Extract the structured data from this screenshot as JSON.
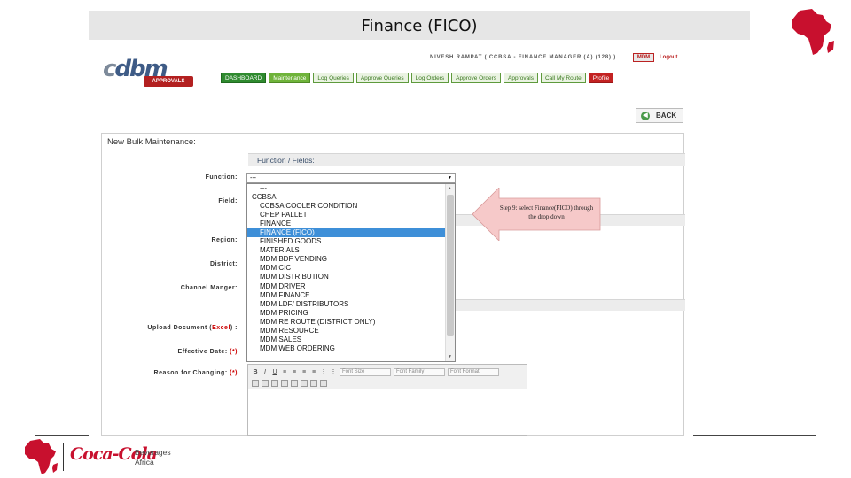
{
  "slide": {
    "title": "Finance (FICO)"
  },
  "app": {
    "brand_part1": "c",
    "brand_part2": "dbm",
    "approvals_badge": "APPROVALS",
    "user_line": "NIVESH RAMPAT ( CCBSA - FINANCE MANAGER (A) (128) )",
    "mdm_badge": "MDM",
    "logout": "Logout",
    "nav": [
      {
        "label": "DASHBOARD",
        "style": "dark"
      },
      {
        "label": "Maintenance",
        "style": "sel"
      },
      {
        "label": "Log Queries",
        "style": "normal"
      },
      {
        "label": "Approve Queries",
        "style": "normal"
      },
      {
        "label": "Log Orders",
        "style": "normal"
      },
      {
        "label": "Approve Orders",
        "style": "normal"
      },
      {
        "label": "Approvals",
        "style": "normal"
      },
      {
        "label": "Call My Route",
        "style": "normal"
      },
      {
        "label": "Profile",
        "style": "red"
      }
    ],
    "back_label": "BACK",
    "back_icon": "arrow-left-icon"
  },
  "form": {
    "panel_title": "New Bulk Maintenance:",
    "section_title": "Function / Fields:",
    "labels": {
      "function": "Function:",
      "field": "Field:",
      "region": "Region:",
      "district": "District:",
      "channel_manager": "Channel Manger:",
      "upload_prefix": "Upload Document (",
      "upload_hl": "Excel",
      "upload_suffix": ") :",
      "effective_date": "Effective Date: ",
      "effective_req": "(*)",
      "reason": "Reason for Changing: ",
      "reason_req": "(*)"
    },
    "function_value": "---",
    "dropdown_options": [
      {
        "label": "---",
        "group": false,
        "selected": false
      },
      {
        "label": "CCBSA",
        "group": true,
        "selected": false
      },
      {
        "label": "CCBSA COOLER CONDITION",
        "group": false,
        "selected": false
      },
      {
        "label": "CHEP PALLET",
        "group": false,
        "selected": false
      },
      {
        "label": "FINANCE",
        "group": false,
        "selected": false
      },
      {
        "label": "FINANCE (FICO)",
        "group": false,
        "selected": true
      },
      {
        "label": "FINISHED GOODS",
        "group": false,
        "selected": false
      },
      {
        "label": "MATERIALS",
        "group": false,
        "selected": false
      },
      {
        "label": "MDM BDF VENDING",
        "group": false,
        "selected": false
      },
      {
        "label": "MDM CIC",
        "group": false,
        "selected": false
      },
      {
        "label": "MDM DISTRIBUTION",
        "group": false,
        "selected": false
      },
      {
        "label": "MDM DRIVER",
        "group": false,
        "selected": false
      },
      {
        "label": "MDM FINANCE",
        "group": false,
        "selected": false
      },
      {
        "label": "MDM LDF/ DISTRIBUTORS",
        "group": false,
        "selected": false
      },
      {
        "label": "MDM PRICING",
        "group": false,
        "selected": false
      },
      {
        "label": "MDM RE ROUTE (DISTRICT ONLY)",
        "group": false,
        "selected": false
      },
      {
        "label": "MDM RESOURCE",
        "group": false,
        "selected": false
      },
      {
        "label": "MDM SALES",
        "group": false,
        "selected": false
      },
      {
        "label": "MDM WEB ORDERING",
        "group": false,
        "selected": false
      }
    ],
    "editor": {
      "font_size": "Font Size",
      "font_family": "Font Family",
      "font_format": "Font Format"
    }
  },
  "callout": {
    "text": "Step 9: select Finance(FICO) through the drop down"
  },
  "footer": {
    "brand": "Coca-Cola",
    "beverages": "Beverages",
    "africa": "Africa"
  },
  "colors": {
    "brand_red": "#c8102e",
    "nav_green": "#2f8a2f",
    "selected_blue": "#3e8fd8",
    "callout_fill": "#f6c9c9"
  }
}
